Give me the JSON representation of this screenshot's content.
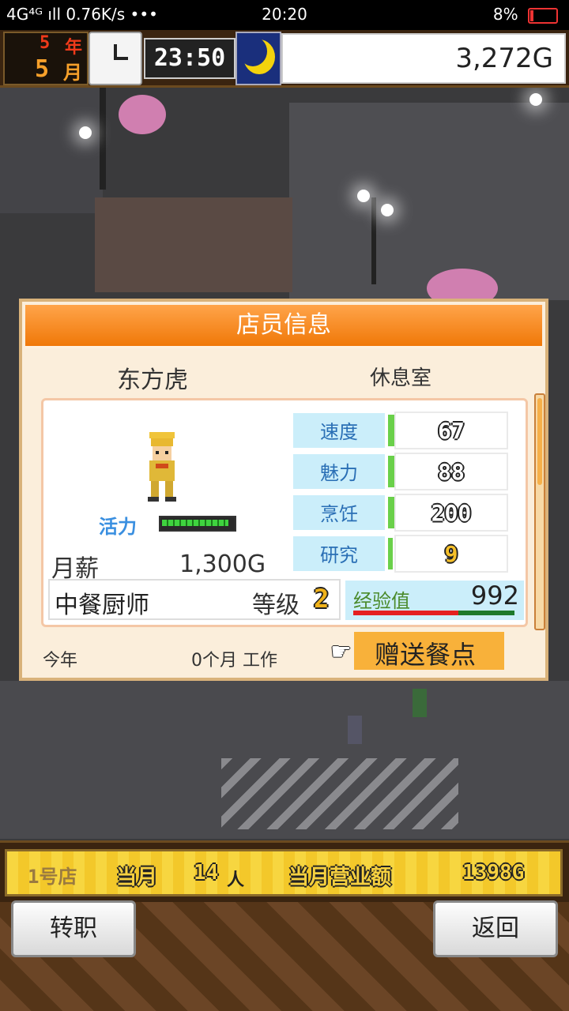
{
  "status_bar": {
    "network": "4G⁴ᴳ ıll 0.76K/s •••",
    "time": "20:20",
    "battery": "8%"
  },
  "top_bar": {
    "year_num": "5",
    "year_label": "年",
    "month_num": "5",
    "month_label": "月",
    "game_time": "23:50",
    "money": "3,272G"
  },
  "panel": {
    "title": "店员信息",
    "staff_name": "东方虎",
    "location": "休息室",
    "vitality_label": "活力",
    "vitality_level": 0.95,
    "salary_label": "月薪",
    "salary_value": "1,300G",
    "stats": [
      {
        "name": "速度",
        "value": "67",
        "level": 0.05
      },
      {
        "name": "魅力",
        "value": "88",
        "level": 0.07
      },
      {
        "name": "烹饪",
        "value": "200",
        "level": 0.18
      },
      {
        "name": "研究",
        "value": "9",
        "level": 0.02
      }
    ],
    "job": "中餐厨师",
    "level_label": "等级",
    "level_value": "2",
    "exp_label": "经验值",
    "exp_value": "992",
    "exp_progress": 0.65,
    "year_text": "今年",
    "months_text": "0个月 工作",
    "gift_label": "赠送餐点"
  },
  "bottom_bar": {
    "store": "1号店",
    "month_label": "当月",
    "customers": "14",
    "revenue_label": "当月营业额",
    "revenue": "1398G"
  },
  "buttons": {
    "transfer": "转职",
    "back": "返回"
  }
}
